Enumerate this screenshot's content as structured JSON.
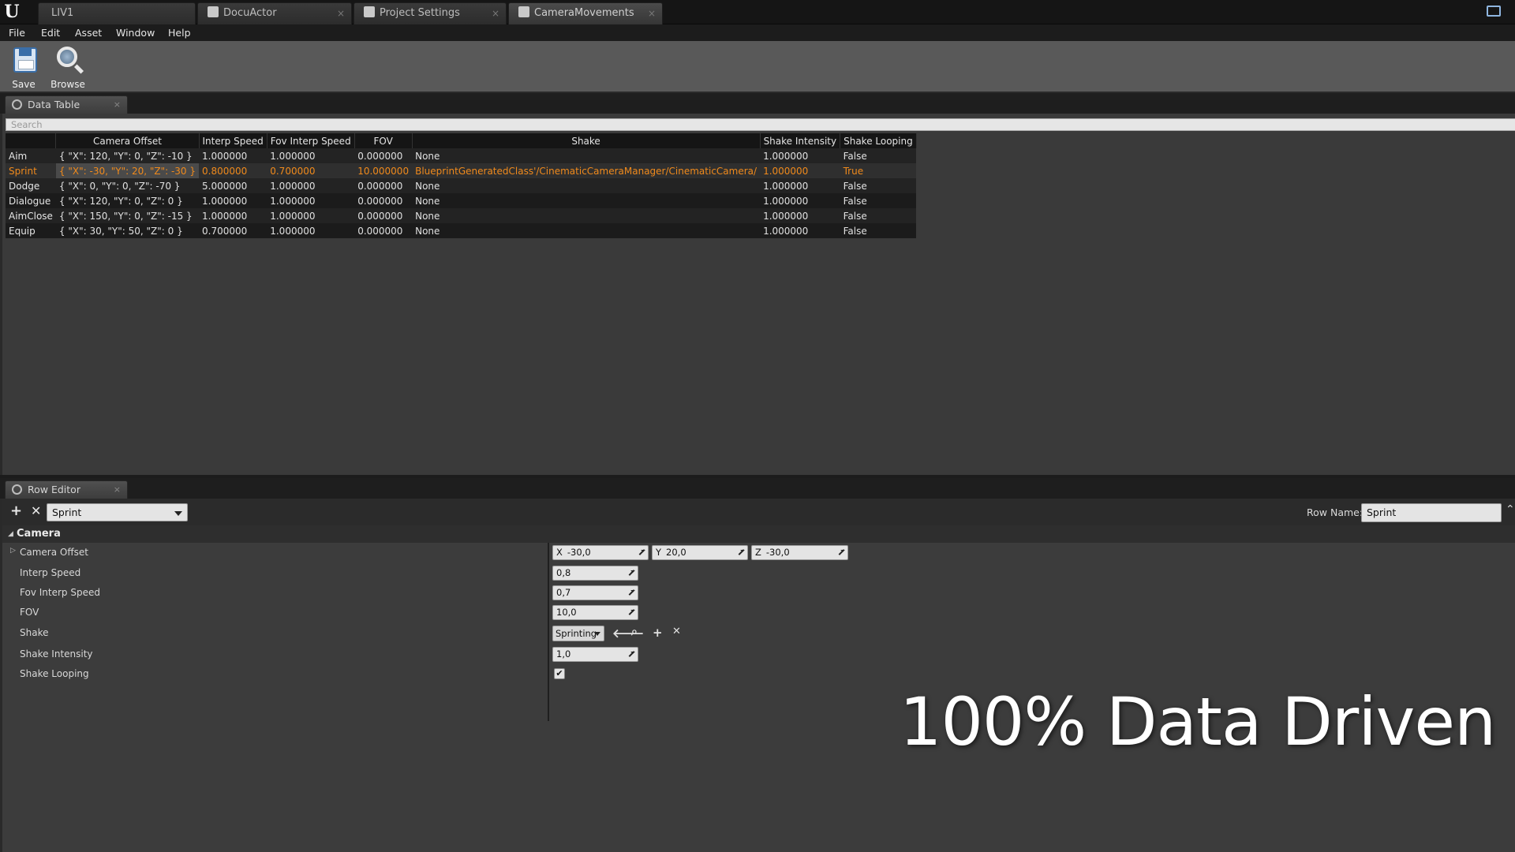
{
  "tabs": {
    "level": "LIV1",
    "docuactor": "DocuActor",
    "project_settings": "Project Settings",
    "camera_movements": "CameraMovements"
  },
  "menu": [
    "File",
    "Edit",
    "Asset",
    "Window",
    "Help"
  ],
  "toolbar": {
    "save_label": "Save",
    "browse_label": "Browse"
  },
  "data_table": {
    "tab_label": "Data Table",
    "search_placeholder": "Search",
    "columns": [
      "",
      "Camera Offset",
      "Interp Speed",
      "Fov Interp Speed",
      "FOV",
      "Shake",
      "Shake Intensity",
      "Shake Looping"
    ],
    "rows": [
      [
        "Aim",
        "{ \"X\": 120, \"Y\": 0, \"Z\": -10 }",
        "1.000000",
        "1.000000",
        "0.000000",
        "None",
        "1.000000",
        "False"
      ],
      [
        "Sprint",
        "{ \"X\": -30, \"Y\": 20, \"Z\": -30 }",
        "0.800000",
        "0.700000",
        "10.000000",
        "BlueprintGeneratedClass'/CinematicCameraManager/CinematicCamera/",
        "1.000000",
        "True"
      ],
      [
        "Dodge",
        "{ \"X\": 0, \"Y\": 0, \"Z\": -70 }",
        "5.000000",
        "1.000000",
        "0.000000",
        "None",
        "1.000000",
        "False"
      ],
      [
        "Dialogue",
        "{ \"X\": 120, \"Y\": 0, \"Z\": 0 }",
        "1.000000",
        "1.000000",
        "0.000000",
        "None",
        "1.000000",
        "False"
      ],
      [
        "AimClose",
        "{ \"X\": 150, \"Y\": 0, \"Z\": -15 }",
        "1.000000",
        "1.000000",
        "0.000000",
        "None",
        "1.000000",
        "False"
      ],
      [
        "Equip",
        "{ \"X\": 30, \"Y\": 50, \"Z\": 0 }",
        "0.700000",
        "1.000000",
        "0.000000",
        "None",
        "1.000000",
        "False"
      ]
    ],
    "selected_row": "Sprint"
  },
  "row_editor": {
    "tab_label": "Row Editor",
    "selected_row": "Sprint",
    "row_name_label": "Row Name:",
    "row_name_value": "Sprint",
    "category": "Camera",
    "properties": {
      "camera_offset": {
        "label": "Camera Offset",
        "x": "-30,0",
        "y": "20,0",
        "z": "-30,0"
      },
      "interp_speed": {
        "label": "Interp Speed",
        "value": "0,8"
      },
      "fov_interp_speed": {
        "label": "Fov Interp Speed",
        "value": "0,7"
      },
      "fov": {
        "label": "FOV",
        "value": "10,0"
      },
      "shake": {
        "label": "Shake",
        "value": "Sprinting"
      },
      "shake_intensity": {
        "label": "Shake Intensity",
        "value": "1,0"
      },
      "shake_looping": {
        "label": "Shake Looping",
        "checked": true
      }
    },
    "axis_labels": {
      "x": "X",
      "y": "Y",
      "z": "Z"
    }
  },
  "caption": "100% Data Driven",
  "colors": {
    "selected_text": "#f08a1c",
    "background": "#3c3c3c"
  }
}
